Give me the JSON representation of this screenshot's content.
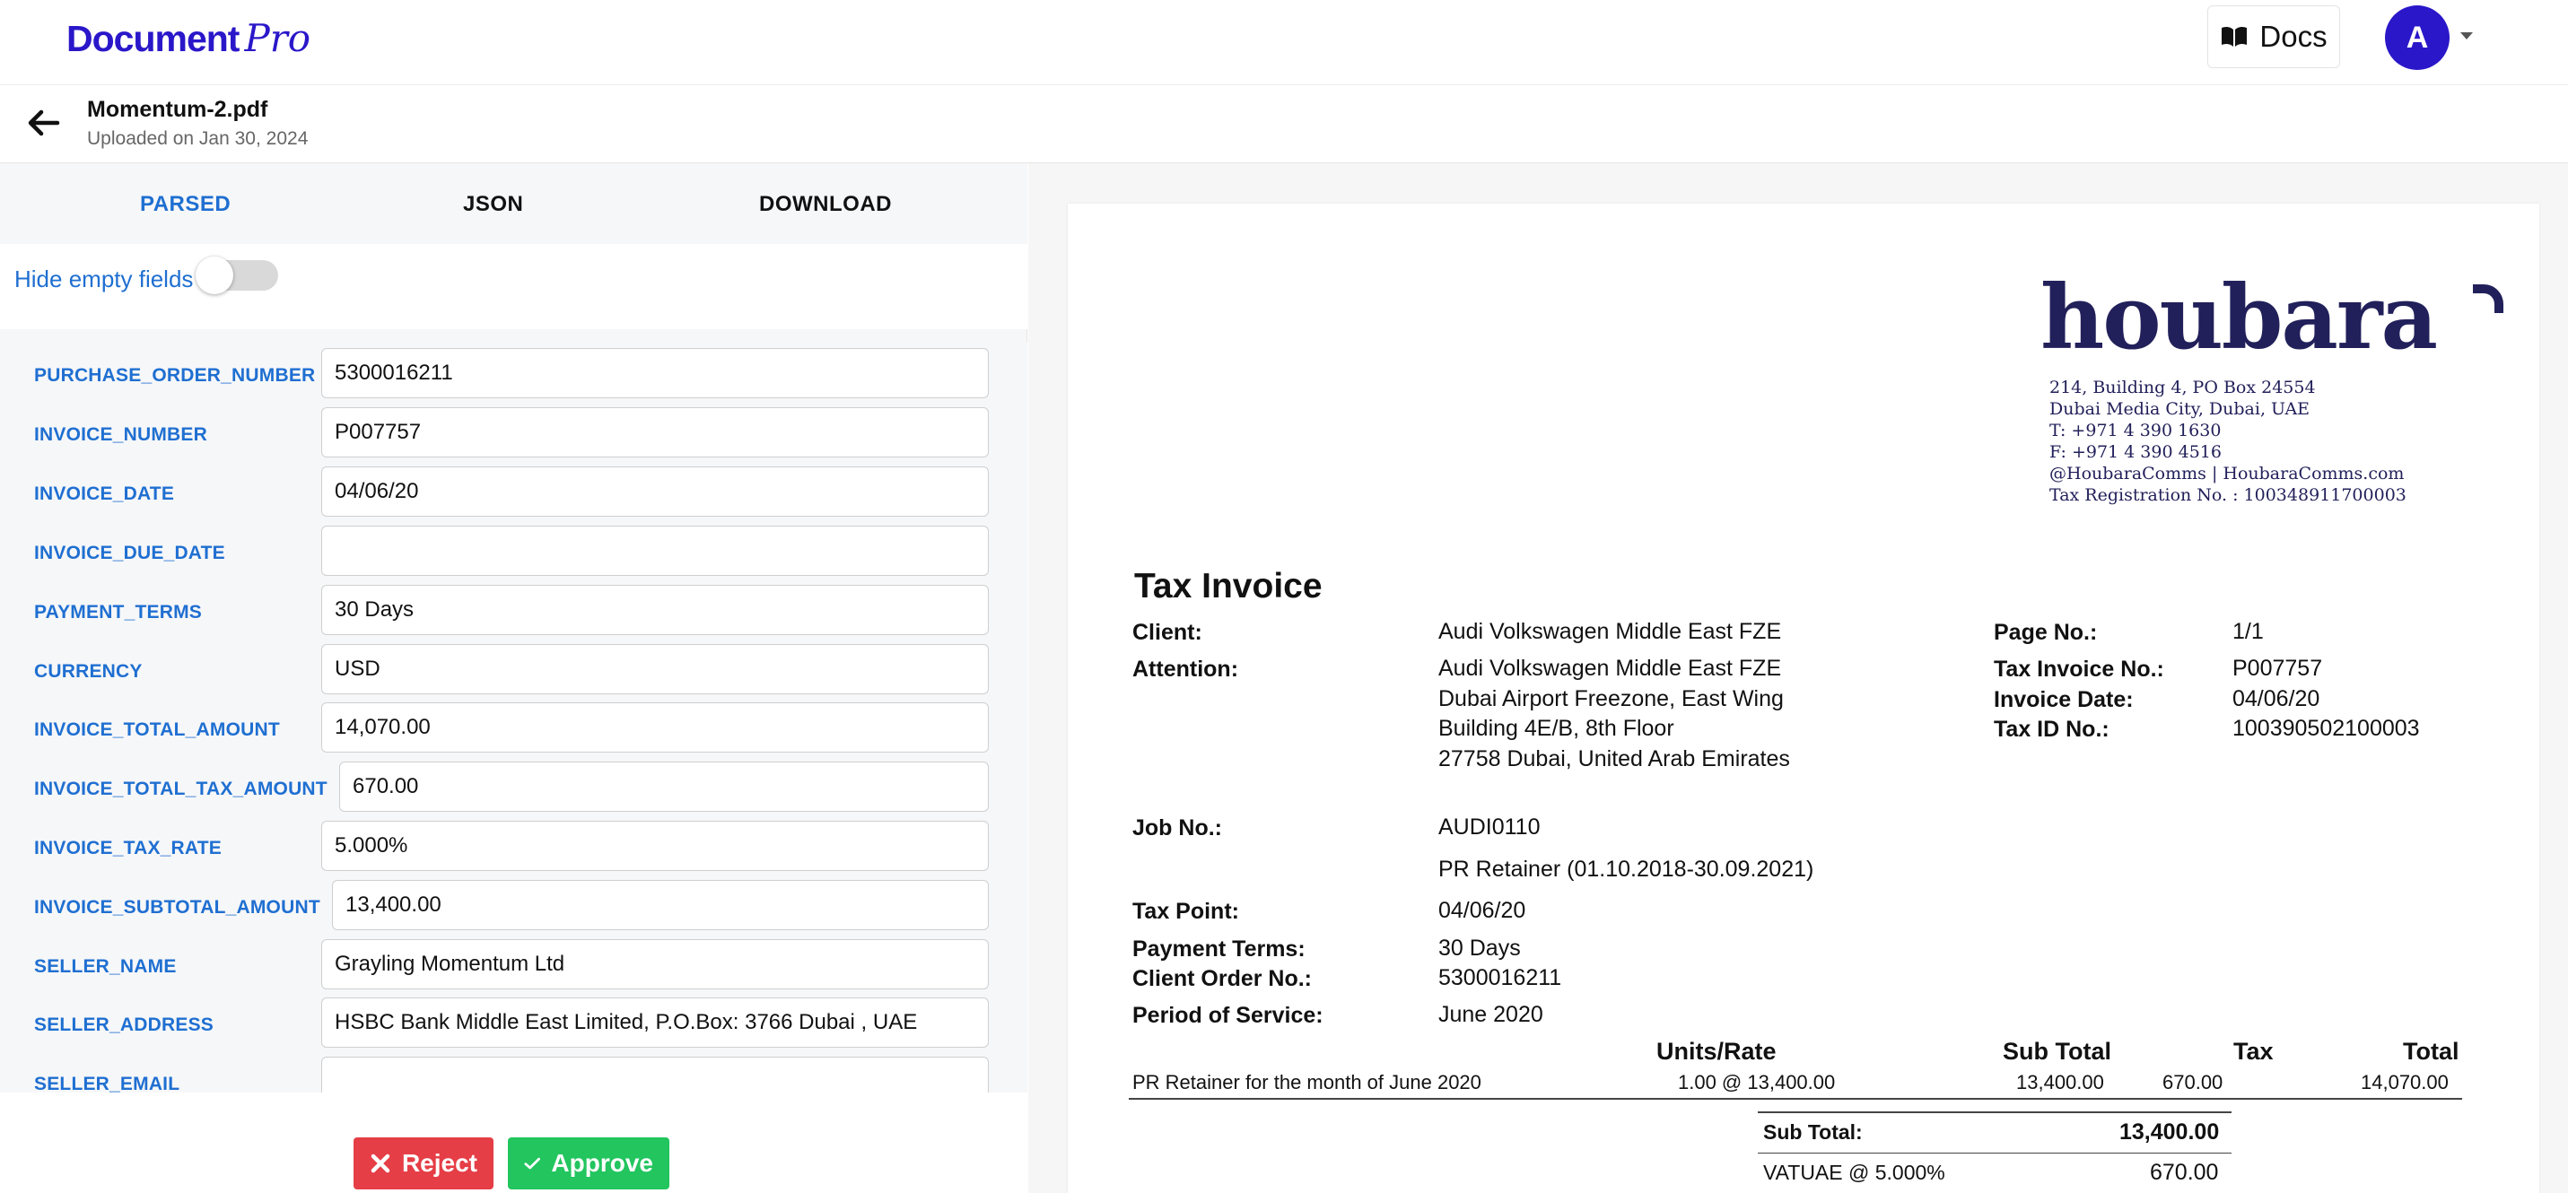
{
  "app": {
    "brand_main": "Document",
    "brand_pro": "Pro",
    "docs_label": "Docs",
    "avatar_letter": "A"
  },
  "file": {
    "name": "Momentum-2.pdf",
    "uploaded": "Uploaded on Jan 30, 2024"
  },
  "tabs": [
    {
      "label": "PARSED"
    },
    {
      "label": "JSON"
    },
    {
      "label": "DOWNLOAD"
    }
  ],
  "toggle": {
    "label": "Hide empty fields",
    "on": false
  },
  "fields": [
    {
      "label": "PURCHASE_ORDER_NUMBER",
      "value": "5300016211"
    },
    {
      "label": "INVOICE_NUMBER",
      "value": "P007757"
    },
    {
      "label": "INVOICE_DATE",
      "value": "04/06/20"
    },
    {
      "label": "INVOICE_DUE_DATE",
      "value": ""
    },
    {
      "label": "PAYMENT_TERMS",
      "value": "30 Days"
    },
    {
      "label": "CURRENCY",
      "value": "USD"
    },
    {
      "label": "INVOICE_TOTAL_AMOUNT",
      "value": "14,070.00"
    },
    {
      "label": "INVOICE_TOTAL_TAX_AMOUNT",
      "value": "670.00"
    },
    {
      "label": "INVOICE_TAX_RATE",
      "value": "5.000%"
    },
    {
      "label": "INVOICE_SUBTOTAL_AMOUNT",
      "value": "13,400.00"
    },
    {
      "label": "SELLER_NAME",
      "value": "Grayling Momentum Ltd"
    },
    {
      "label": "SELLER_ADDRESS",
      "value": "HSBC Bank Middle East Limited, P.O.Box: 3766 Dubai , UAE"
    },
    {
      "label": "SELLER_EMAIL",
      "value": ""
    }
  ],
  "actions": {
    "reject": "Reject",
    "approve": "Approve"
  },
  "colors": {
    "brand": "#2a17c9",
    "accent": "#1f6fd1",
    "reject": "#e53e46",
    "approve": "#22c55e",
    "logo": "#22205a"
  },
  "document": {
    "logo": "houbara",
    "address_lines": [
      "214, Building 4, PO Box 24554",
      "Dubai Media City, Dubai, UAE",
      "T: +971 4 390 1630",
      "F: +971 4 390 4516",
      "@HoubaraComms | HoubaraComms.com",
      "Tax Registration No. : 100348911700003"
    ],
    "title": "Tax Invoice",
    "client_label": "Client:",
    "client_value": "Audi Volkswagen Middle East FZE",
    "attention_label": "Attention:",
    "attention_lines": [
      "Audi Volkswagen Middle East FZE",
      "Dubai Airport Freezone, East Wing",
      "Building 4E/B, 8th Floor",
      "27758 Dubai, United Arab Emirates"
    ],
    "page_label": "Page No.:",
    "page_value": "1/1",
    "taxinv_label": "Tax Invoice No.:",
    "taxinv_value": "P007757",
    "invdate_label": "Invoice Date:",
    "invdate_value": "04/06/20",
    "taxid_label": "Tax ID No.:",
    "taxid_value": "100390502100003",
    "job_label": "Job No.:",
    "job_value": "AUDI0110",
    "description": "PR Retainer (01.10.2018-30.09.2021)",
    "taxpoint_label": "Tax Point:",
    "taxpoint_value": "04/06/20",
    "terms_label": "Payment Terms:",
    "terms_value": "30 Days",
    "order_label": "Client Order No.:",
    "order_value": "5300016211",
    "period_label": "Period of Service:",
    "period_value": "June 2020",
    "table_headers": {
      "units": "Units/Rate",
      "subtotal": "Sub Total",
      "tax": "Tax",
      "total": "Total"
    },
    "line_item": {
      "desc": "PR Retainer for the month of June 2020",
      "units": "1.00 @ 13,400.00",
      "subtotal": "13,400.00",
      "tax": "670.00",
      "total": "14,070.00"
    },
    "summary_subtotal_label": "Sub Total:",
    "summary_subtotal_value": "13,400.00",
    "summary_vat_label": "VATUAE @ 5.000%",
    "summary_vat_value": "670.00"
  }
}
